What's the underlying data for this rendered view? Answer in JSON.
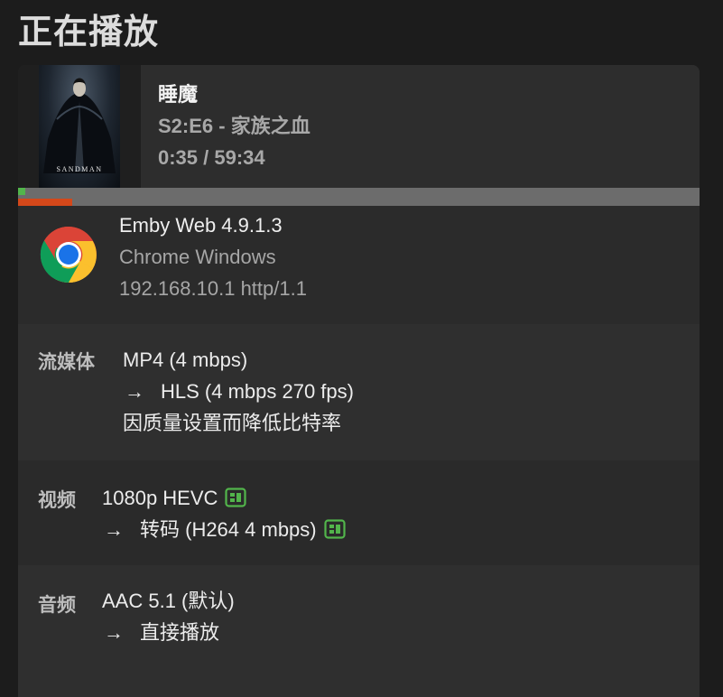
{
  "page": {
    "title": "正在播放"
  },
  "session": {
    "series_title": "睡魔",
    "poster_caption": "SANDMAN",
    "episode": "S2:E6 - 家族之血",
    "time": "0:35 / 59:34",
    "progress": {
      "played_fraction": 0.01,
      "transcode_fraction": 0.08,
      "colors": {
        "track": "#6c6c6c",
        "played": "#52b54b",
        "transcode": "#d4481a"
      }
    }
  },
  "client": {
    "app": "Emby Web 4.9.1.3",
    "device": "Chrome Windows",
    "address": "192.168.10.1 http/1.1",
    "icon": "chrome-icon"
  },
  "stream": {
    "label": "流媒体",
    "source": "MP4 (4 mbps)",
    "arrow": "→",
    "target": "HLS (4 mbps 270 fps)",
    "reason": "因质量设置而降低比特率"
  },
  "video": {
    "label": "视频",
    "source": "1080p HEVC",
    "arrow": "→",
    "target": "转码 (H264 4 mbps)",
    "icon": "hardware-acceleration-icon",
    "icon_color": "#52b54b"
  },
  "audio": {
    "label": "音频",
    "source": "AAC 5.1 (默认)",
    "arrow": "→",
    "target": "直接播放"
  }
}
